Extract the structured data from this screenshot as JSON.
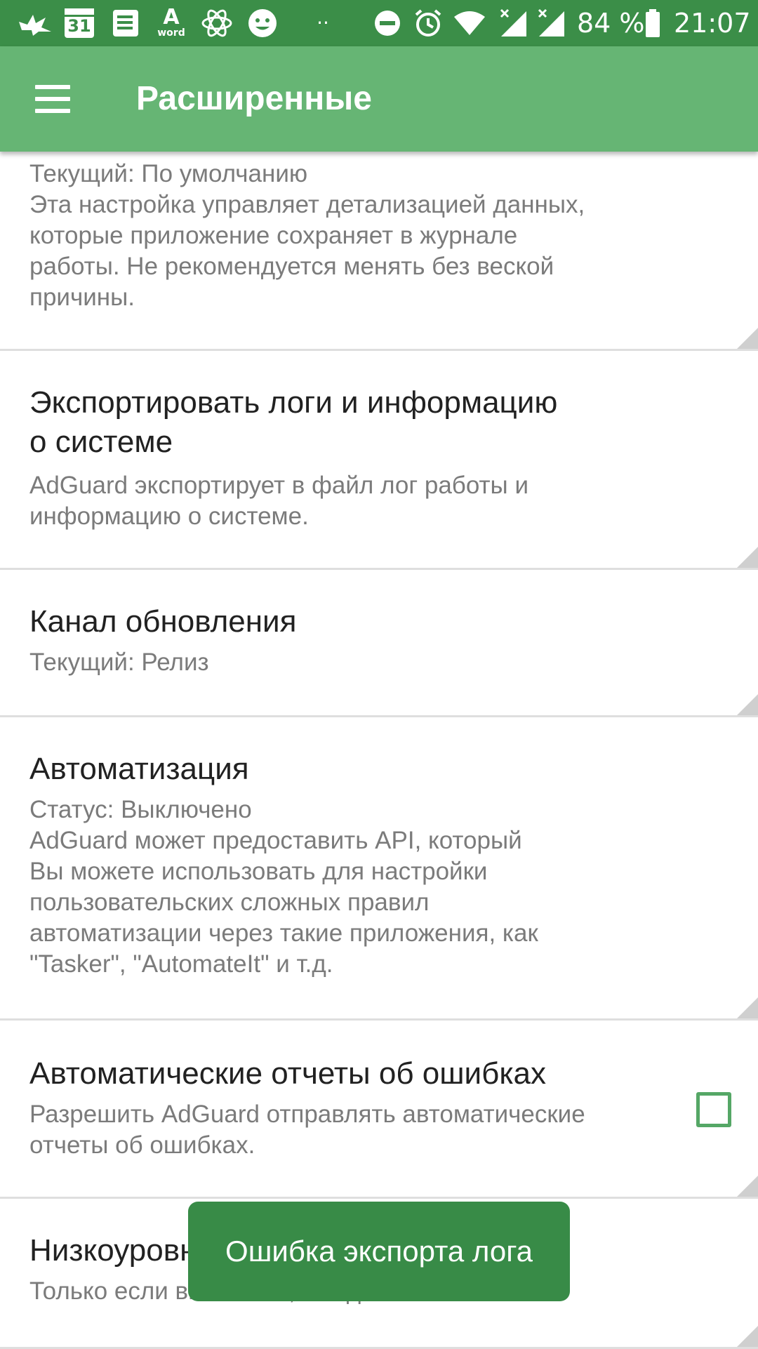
{
  "status_bar": {
    "calendar_day": "31",
    "word_letter": "A",
    "word_label": "word",
    "more": "··",
    "battery": "84 %",
    "time": "21:07"
  },
  "app_bar": {
    "title": "Расширенные"
  },
  "items": [
    {
      "summary_lines": [
        "Текущий: По умолчанию",
        "Эта настройка управляет детализацией данных,",
        "которые приложение сохраняет в журнале",
        "работы. Не рекомендуется менять без веской",
        "причины."
      ]
    },
    {
      "title_lines": [
        "Экспортировать логи и информацию",
        "о системе"
      ],
      "summary_lines": [
        "AdGuard экспортирует в файл лог работы и",
        "информацию о системе."
      ]
    },
    {
      "title": "Канал обновления",
      "summary_lines": [
        "Текущий: Релиз"
      ]
    },
    {
      "title": "Автоматизация",
      "summary_lines": [
        "Статус: Выключено",
        "AdGuard может предоставить API, который",
        "Вы можете использовать для настройки",
        "пользовательских сложных правил",
        "автоматизации через такие приложения, как",
        "\"Tasker\", \"AutomateIt\" и т.д."
      ]
    },
    {
      "title": "Автоматические отчеты об ошибках",
      "summary_lines": [
        "Разрешить AdGuard отправлять автоматические",
        "отчеты об ошибках."
      ],
      "checked": false
    },
    {
      "title": "Низкоуровневые настройки",
      "summary_lines": [
        "Только если вы знаете, что делаете"
      ]
    }
  ],
  "toast": {
    "message": "Ошибка экспорта лога"
  },
  "colors": {
    "status_bar": "#3b8e48",
    "app_bar": "#66b574",
    "toast": "#388b47",
    "checkbox": "#55a766"
  }
}
